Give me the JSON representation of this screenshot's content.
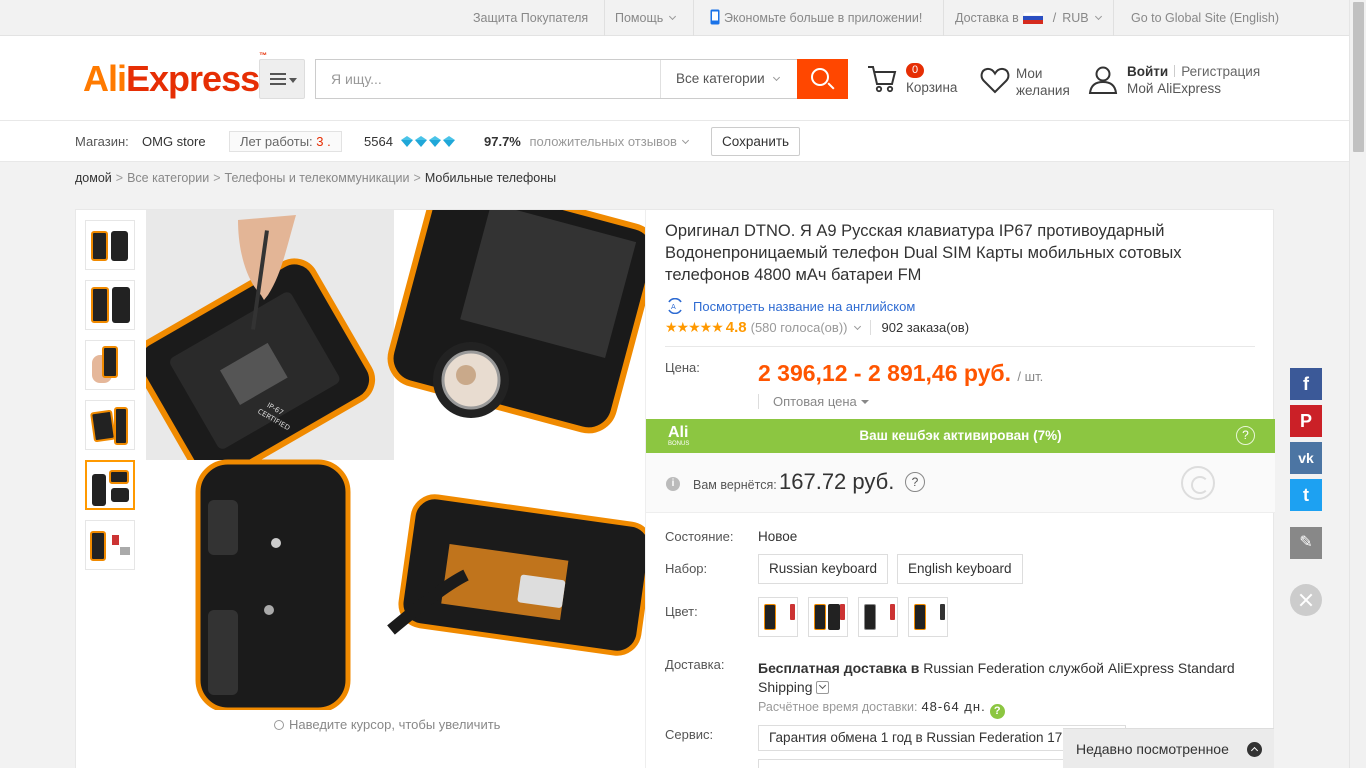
{
  "topbar": {
    "buyer_protection": "Защита Покупателя",
    "help": "Помощь",
    "app_promo": "Экономьте больше в приложении!",
    "ship_to": "Доставка в",
    "currency_sep": "/",
    "currency": "RUB",
    "global_site": "Go to Global Site (English)"
  },
  "header": {
    "logo_ali": "Ali",
    "logo_express": "Express",
    "logo_tm": "™",
    "search_placeholder": "Я ищу...",
    "category_select": "Все категории",
    "cart_count": "0",
    "cart_label": "Корзина",
    "wishlist_label": "Мои желания",
    "signin": "Войти",
    "register": "Регистрация",
    "my_aliexpress": "Мой AliExpress"
  },
  "store": {
    "store_label": "Магазин:",
    "store_name": "OMG store",
    "years_label": "Лет работы:",
    "years_value": "3 .",
    "score": "5564",
    "positive_pct": "97.7%",
    "positive_label": "положительных отзывов",
    "save_button": "Сохранить"
  },
  "breadcrumb": [
    "домой",
    "Все категории",
    "Телефоны и телекоммуникации",
    "Мобильные телефоны"
  ],
  "breadcrumb_sep": ">",
  "gallery": {
    "zoom_hint": "Наведите курсор, чтобы увеличить",
    "selected_index": 4,
    "sticker_line1": "IP-67",
    "sticker_line2": "CERTIFIED"
  },
  "product": {
    "title": "Оригинал DTNO. Я A9 Русская клавиатура IP67 противоударный Водонепроницаемый телефон Dual SIM Карты мобильных сотовых телефонов 4800 мАч батареи FM",
    "translate_link": "Посмотреть название на английском",
    "stars": "★★★★★",
    "rating": "4.8",
    "votes": "(580 голоса(ов))",
    "orders": "902 заказа(ов)",
    "price_label": "Цена:",
    "price": "2 396,12 - 2 891,46 руб.",
    "price_unit": "/ шт.",
    "wholesale": "Оптовая цена"
  },
  "cashback": {
    "badge_top": "Ali",
    "badge_bottom": "BONUS",
    "banner": "Ваш кешбэк активирован (7%)",
    "help": "?",
    "info": "i",
    "return_label": "Вам вернётся:",
    "return_amount": "167.72 руб."
  },
  "options": {
    "condition_label": "Состояние:",
    "condition_value": "Новое",
    "set_label": "Набор:",
    "set_options": [
      "Russian keyboard",
      "English keyboard"
    ],
    "color_label": "Цвет:",
    "delivery_label": "Доставка:",
    "delivery_free": "Бесплатная доставка в",
    "delivery_rest": " Russian Federation службой AliExpress Standard Shipping",
    "eta_label": "Расчётное время доставки:",
    "eta_days": "48-64 дн.",
    "eta_ok": "?",
    "service_label": "Сервис:",
    "service_value": "Гарантия обмена 1 год в Russian Federation 17"
  },
  "social": {
    "facebook": "f",
    "pinterest": "P",
    "vk": "vk",
    "twitter": "t",
    "edit": "✎"
  },
  "recently_viewed": "Недавно посмотренное",
  "colors": {
    "brand_red": "#e62e04",
    "brand_orange": "#ff7a00",
    "price": "#ff5500",
    "cashback_green": "#8cc641",
    "link_blue": "#2e6bd2"
  }
}
